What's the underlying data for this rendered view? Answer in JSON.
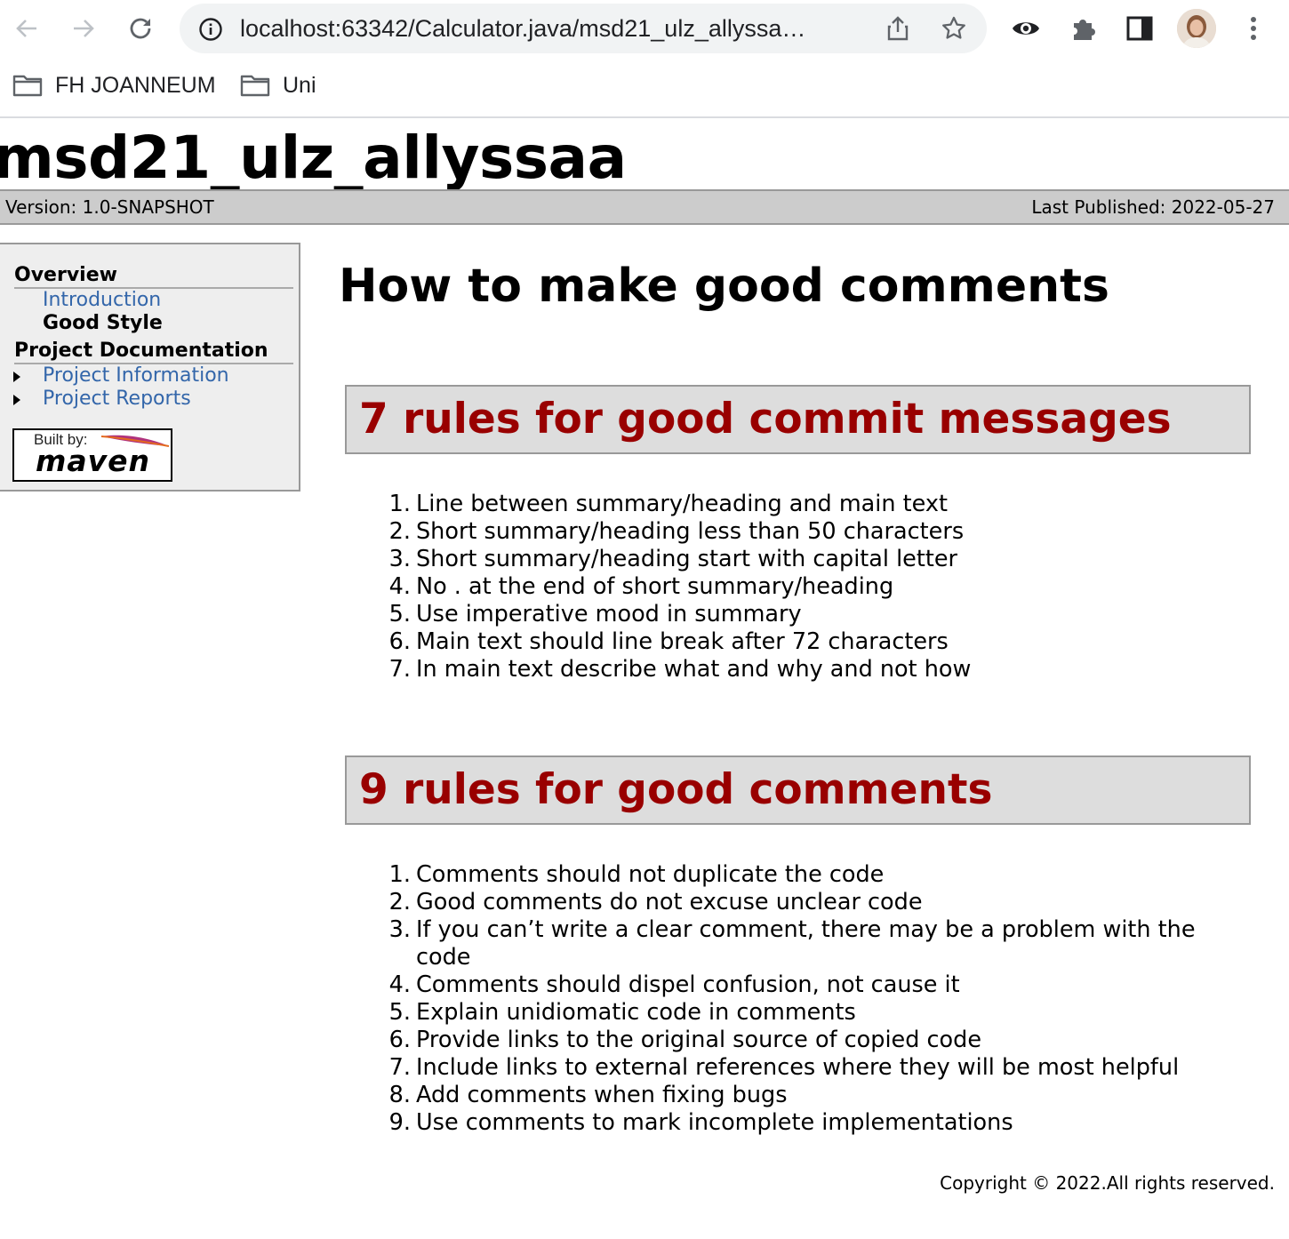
{
  "browser": {
    "url": "localhost:63342/Calculator.java/msd21_ulz_allyssa…",
    "bookmarks": [
      {
        "label": "FH JOANNEUM"
      },
      {
        "label": "Uni"
      }
    ]
  },
  "banner": {
    "title": "msd21_ulz_allyssaa",
    "version": "Version: 1.0-SNAPSHOT",
    "published": "Last Published: 2022-05-27"
  },
  "menu": {
    "overview_heading": "Overview",
    "overview_items": [
      {
        "label": "Introduction",
        "current": false
      },
      {
        "label": "Good Style",
        "current": true
      }
    ],
    "docs_heading": "Project Documentation",
    "docs_items": [
      {
        "label": "Project Information"
      },
      {
        "label": "Project Reports"
      }
    ],
    "badge_top": "Built by:",
    "badge_bottom": "maven"
  },
  "content": {
    "title": "How to make good comments",
    "sections": [
      {
        "heading": "7 rules for good commit messages",
        "items": [
          "Line between summary/heading and main text",
          "Short summary/heading less than 50 characters",
          "Short summary/heading start with capital letter",
          "No . at the end of short summary/heading",
          "Use imperative mood in summary",
          "Main text should line break after 72 characters",
          "In main text describe what and why and not how"
        ]
      },
      {
        "heading": "9 rules for good comments",
        "items": [
          "Comments should not duplicate the code",
          "Good comments do not excuse unclear code",
          "If you can’t write a clear comment, there may be a problem with the code",
          "Comments should dispel confusion, not cause it",
          "Explain unidiomatic code in comments",
          "Provide links to the original source of copied code",
          "Include links to external references where they will be most helpful",
          "Add comments when fixing bugs",
          "Use comments to mark incomplete implementations"
        ]
      }
    ]
  },
  "footer": {
    "copyright": "Copyright © 2022.All rights reserved."
  }
}
